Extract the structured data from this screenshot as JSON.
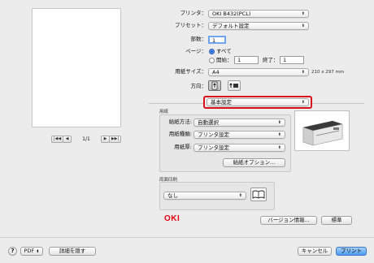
{
  "labels": {
    "printer": "プリンタ：",
    "preset": "プリセット：",
    "copies": "部数：",
    "pages": "ページ：",
    "paper_size": "用紙サイズ：",
    "orientation": "方向："
  },
  "values": {
    "printer": "OKI B432(PCL)",
    "preset": "デフォルト設定",
    "copies": "1",
    "pages_all": "すべて",
    "pages_from_label": "開始：",
    "pages_from": "1",
    "pages_to_label": "終了：",
    "pages_to": "1",
    "paper_size": "A4",
    "paper_dims": "210 x 297 mm",
    "section": "基本設定"
  },
  "preview": {
    "page_indicator": "1/1"
  },
  "paper_group": {
    "title": "用紙",
    "source_label": "給紙方法:",
    "source_value": "自動選択",
    "type_label": "用紙種類:",
    "type_value": "プリンタ設定",
    "weight_label": "用紙厚:",
    "weight_value": "プリンタ設定",
    "options_button": "給紙オプション..."
  },
  "duplex_group": {
    "title": "両面印刷",
    "value": "なし"
  },
  "brand": {
    "logo": "OKI",
    "color": "#e00010"
  },
  "buttons": {
    "version": "バージョン情報...",
    "standard": "標準",
    "pdf": "PDF",
    "hide_details": "詳細を隠す",
    "cancel": "キャンセル",
    "print": "プリント",
    "help": "?"
  },
  "colors": {
    "highlight": "#d8101d",
    "primary_button": "#4a9cf0"
  }
}
